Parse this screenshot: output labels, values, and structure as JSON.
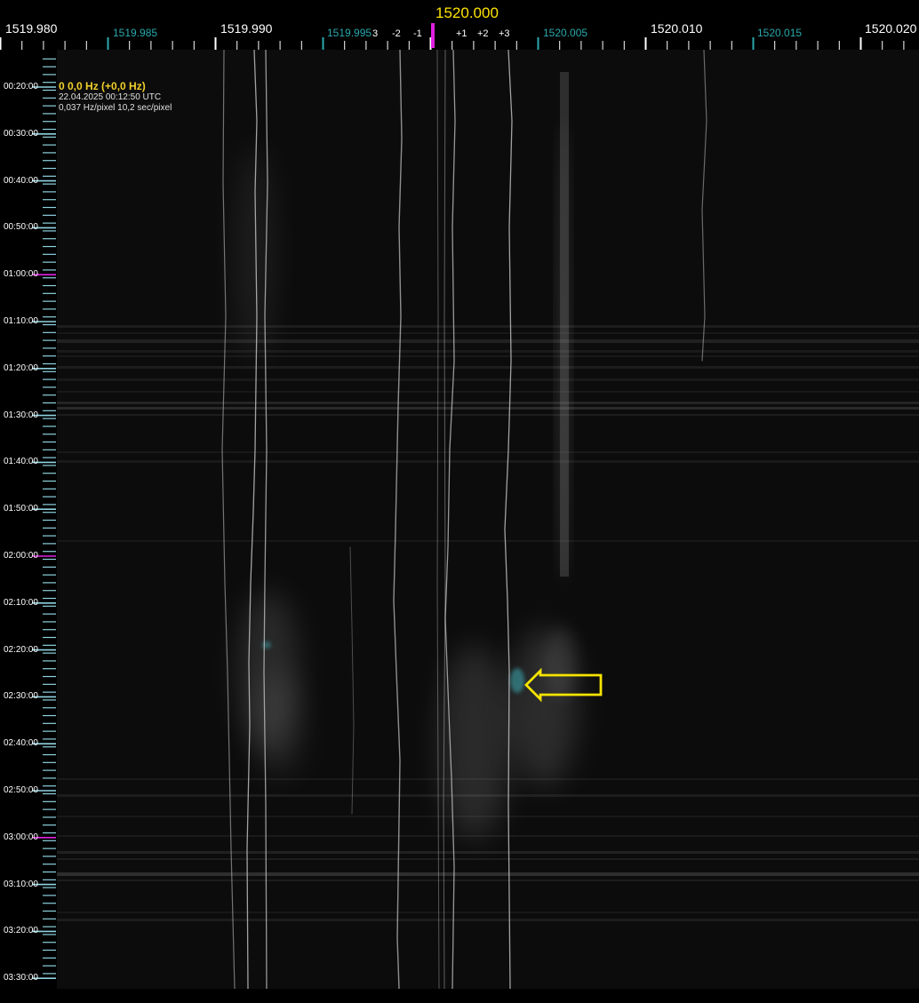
{
  "frequency_ruler": {
    "center_label": "1520.000",
    "major_labels": [
      "1519.980",
      "1519.990",
      "1520.010",
      "1520.020"
    ],
    "minor_labels": [
      "1519.985",
      "1519.995",
      "1520.005",
      "1520.015"
    ],
    "offset_labels": [
      "3",
      "-2",
      "-1",
      "+1",
      "+2",
      "+3"
    ],
    "center_marker_color": "#e020e0",
    "center_label_color": "#ffe300",
    "minor_label_color": "#2aa9ad"
  },
  "info_box": {
    "frequency_readout": "0 0,0 Hz (+0,0 Hz)",
    "timestamp": "22.04.2025 00:12:50 UTC",
    "resolution": "0,037 Hz/pixel 10,2 sec/pixel"
  },
  "time_axis": {
    "labels": [
      "00:20:00",
      "00:30:00",
      "00:40:00",
      "00:50:00",
      "01:00:00",
      "01:10:00",
      "01:20:00",
      "01:30:00",
      "01:40:00",
      "01:50:00",
      "02:00:00",
      "02:10:00",
      "02:20:00",
      "02:30:00",
      "02:40:00",
      "02:50:00",
      "03:00:00",
      "03:10:00",
      "03:20:00",
      "03:30:00"
    ],
    "tick_color": "#8fd3e0",
    "hour_marker_color": "#e020e0"
  },
  "waterfall": {
    "annotation_arrow_color": "#f5e400",
    "trace_color": "#c8c8c8",
    "highlight_color": "#3aa0a8"
  }
}
